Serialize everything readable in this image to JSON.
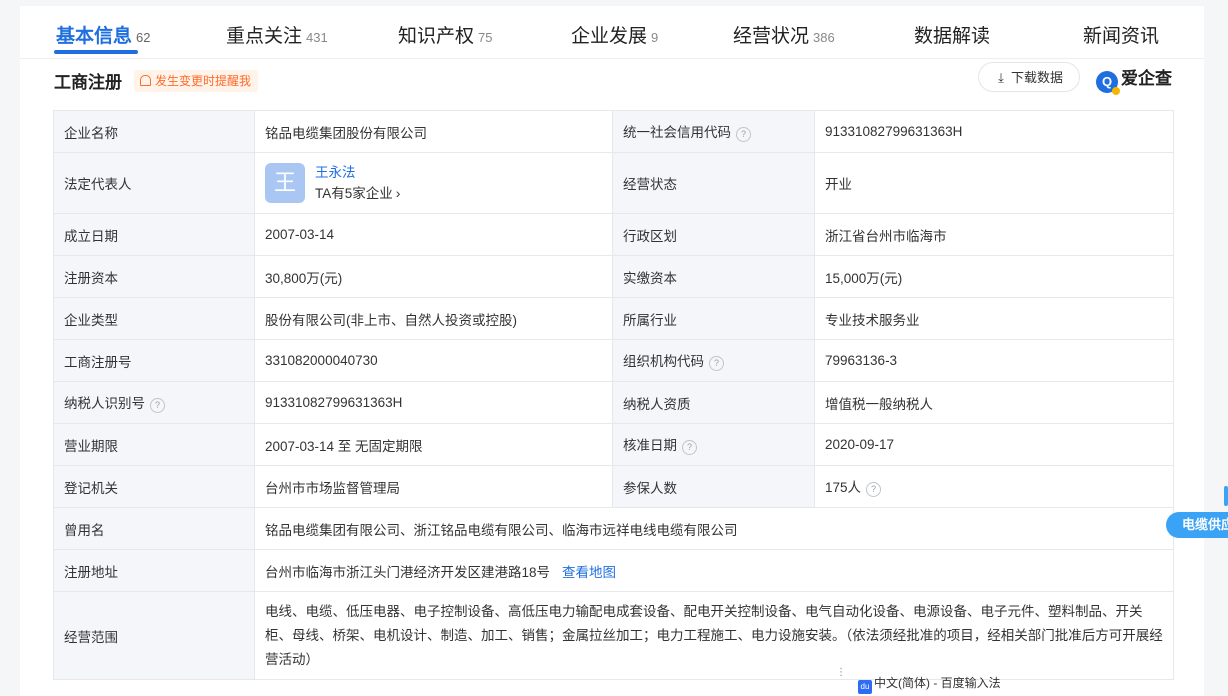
{
  "tabs": [
    {
      "label": "基本信息",
      "count": "62"
    },
    {
      "label": "重点关注",
      "count": "431"
    },
    {
      "label": "知识产权",
      "count": "75"
    },
    {
      "label": "企业发展",
      "count": "9"
    },
    {
      "label": "经营状况",
      "count": "386"
    },
    {
      "label": "数据解读",
      "count": ""
    },
    {
      "label": "新闻资讯",
      "count": ""
    }
  ],
  "section": {
    "title": "工商注册",
    "remind": "发生变更时提醒我",
    "download": "下载数据",
    "brand": "爱企查",
    "brand_letter": "Q"
  },
  "rows": {
    "company_name": {
      "label": "企业名称",
      "value": "铭品电缆集团股份有限公司"
    },
    "credit_code": {
      "label": "统一社会信用代码",
      "value": "91331082799631363H"
    },
    "legal_rep": {
      "label": "法定代表人",
      "avatar": "王",
      "name": "王永法",
      "companies": "TA有5家企业"
    },
    "status": {
      "label": "经营状态",
      "value": "开业"
    },
    "founded": {
      "label": "成立日期",
      "value": "2007-03-14"
    },
    "region": {
      "label": "行政区划",
      "value": "浙江省台州市临海市"
    },
    "reg_capital": {
      "label": "注册资本",
      "value": "30,800万(元)"
    },
    "paid_capital": {
      "label": "实缴资本",
      "value": "15,000万(元)"
    },
    "company_type": {
      "label": "企业类型",
      "value": "股份有限公司(非上市、自然人投资或控股)"
    },
    "industry": {
      "label": "所属行业",
      "value": "专业技术服务业"
    },
    "reg_no": {
      "label": "工商注册号",
      "value": "331082000040730"
    },
    "org_code": {
      "label": "组织机构代码",
      "value": "79963136-3"
    },
    "tax_id": {
      "label": "纳税人识别号",
      "value": "91331082799631363H"
    },
    "tax_qual": {
      "label": "纳税人资质",
      "value": "增值税一般纳税人"
    },
    "term": {
      "label": "营业期限",
      "value": "2007-03-14 至 无固定期限"
    },
    "approve_date": {
      "label": "核准日期",
      "value": "2020-09-17"
    },
    "authority": {
      "label": "登记机关",
      "value": "台州市市场监督管理局"
    },
    "insured": {
      "label": "参保人数",
      "value": "175人"
    },
    "former_names": {
      "label": "曾用名",
      "value": "铭品电缆集团有限公司、浙江铭品电缆有限公司、临海市远祥电线电缆有限公司"
    },
    "address": {
      "label": "注册地址",
      "value": "台州市临海市浙江头门港经济开发区建港路18号",
      "map_link": "查看地图"
    },
    "scope": {
      "label": "经营范围",
      "value": "电线、电缆、低压电器、电子控制设备、高低压电力输配电成套设备、配电开关控制设备、电气自动化设备、电源设备、电子元件、塑料制品、开关柜、母线、桥架、电机设计、制造、加工、销售；金属拉丝加工；电力工程施工、电力设施安装。（依法须经批准的项目，经相关部门批准后方可开展经营活动）"
    }
  },
  "help_glyph": "?",
  "side_tag": "电缆供应",
  "toolbar": {
    "dots": "⋮",
    "du": "du",
    "text": "中文(简体) - 百度输入法"
  }
}
